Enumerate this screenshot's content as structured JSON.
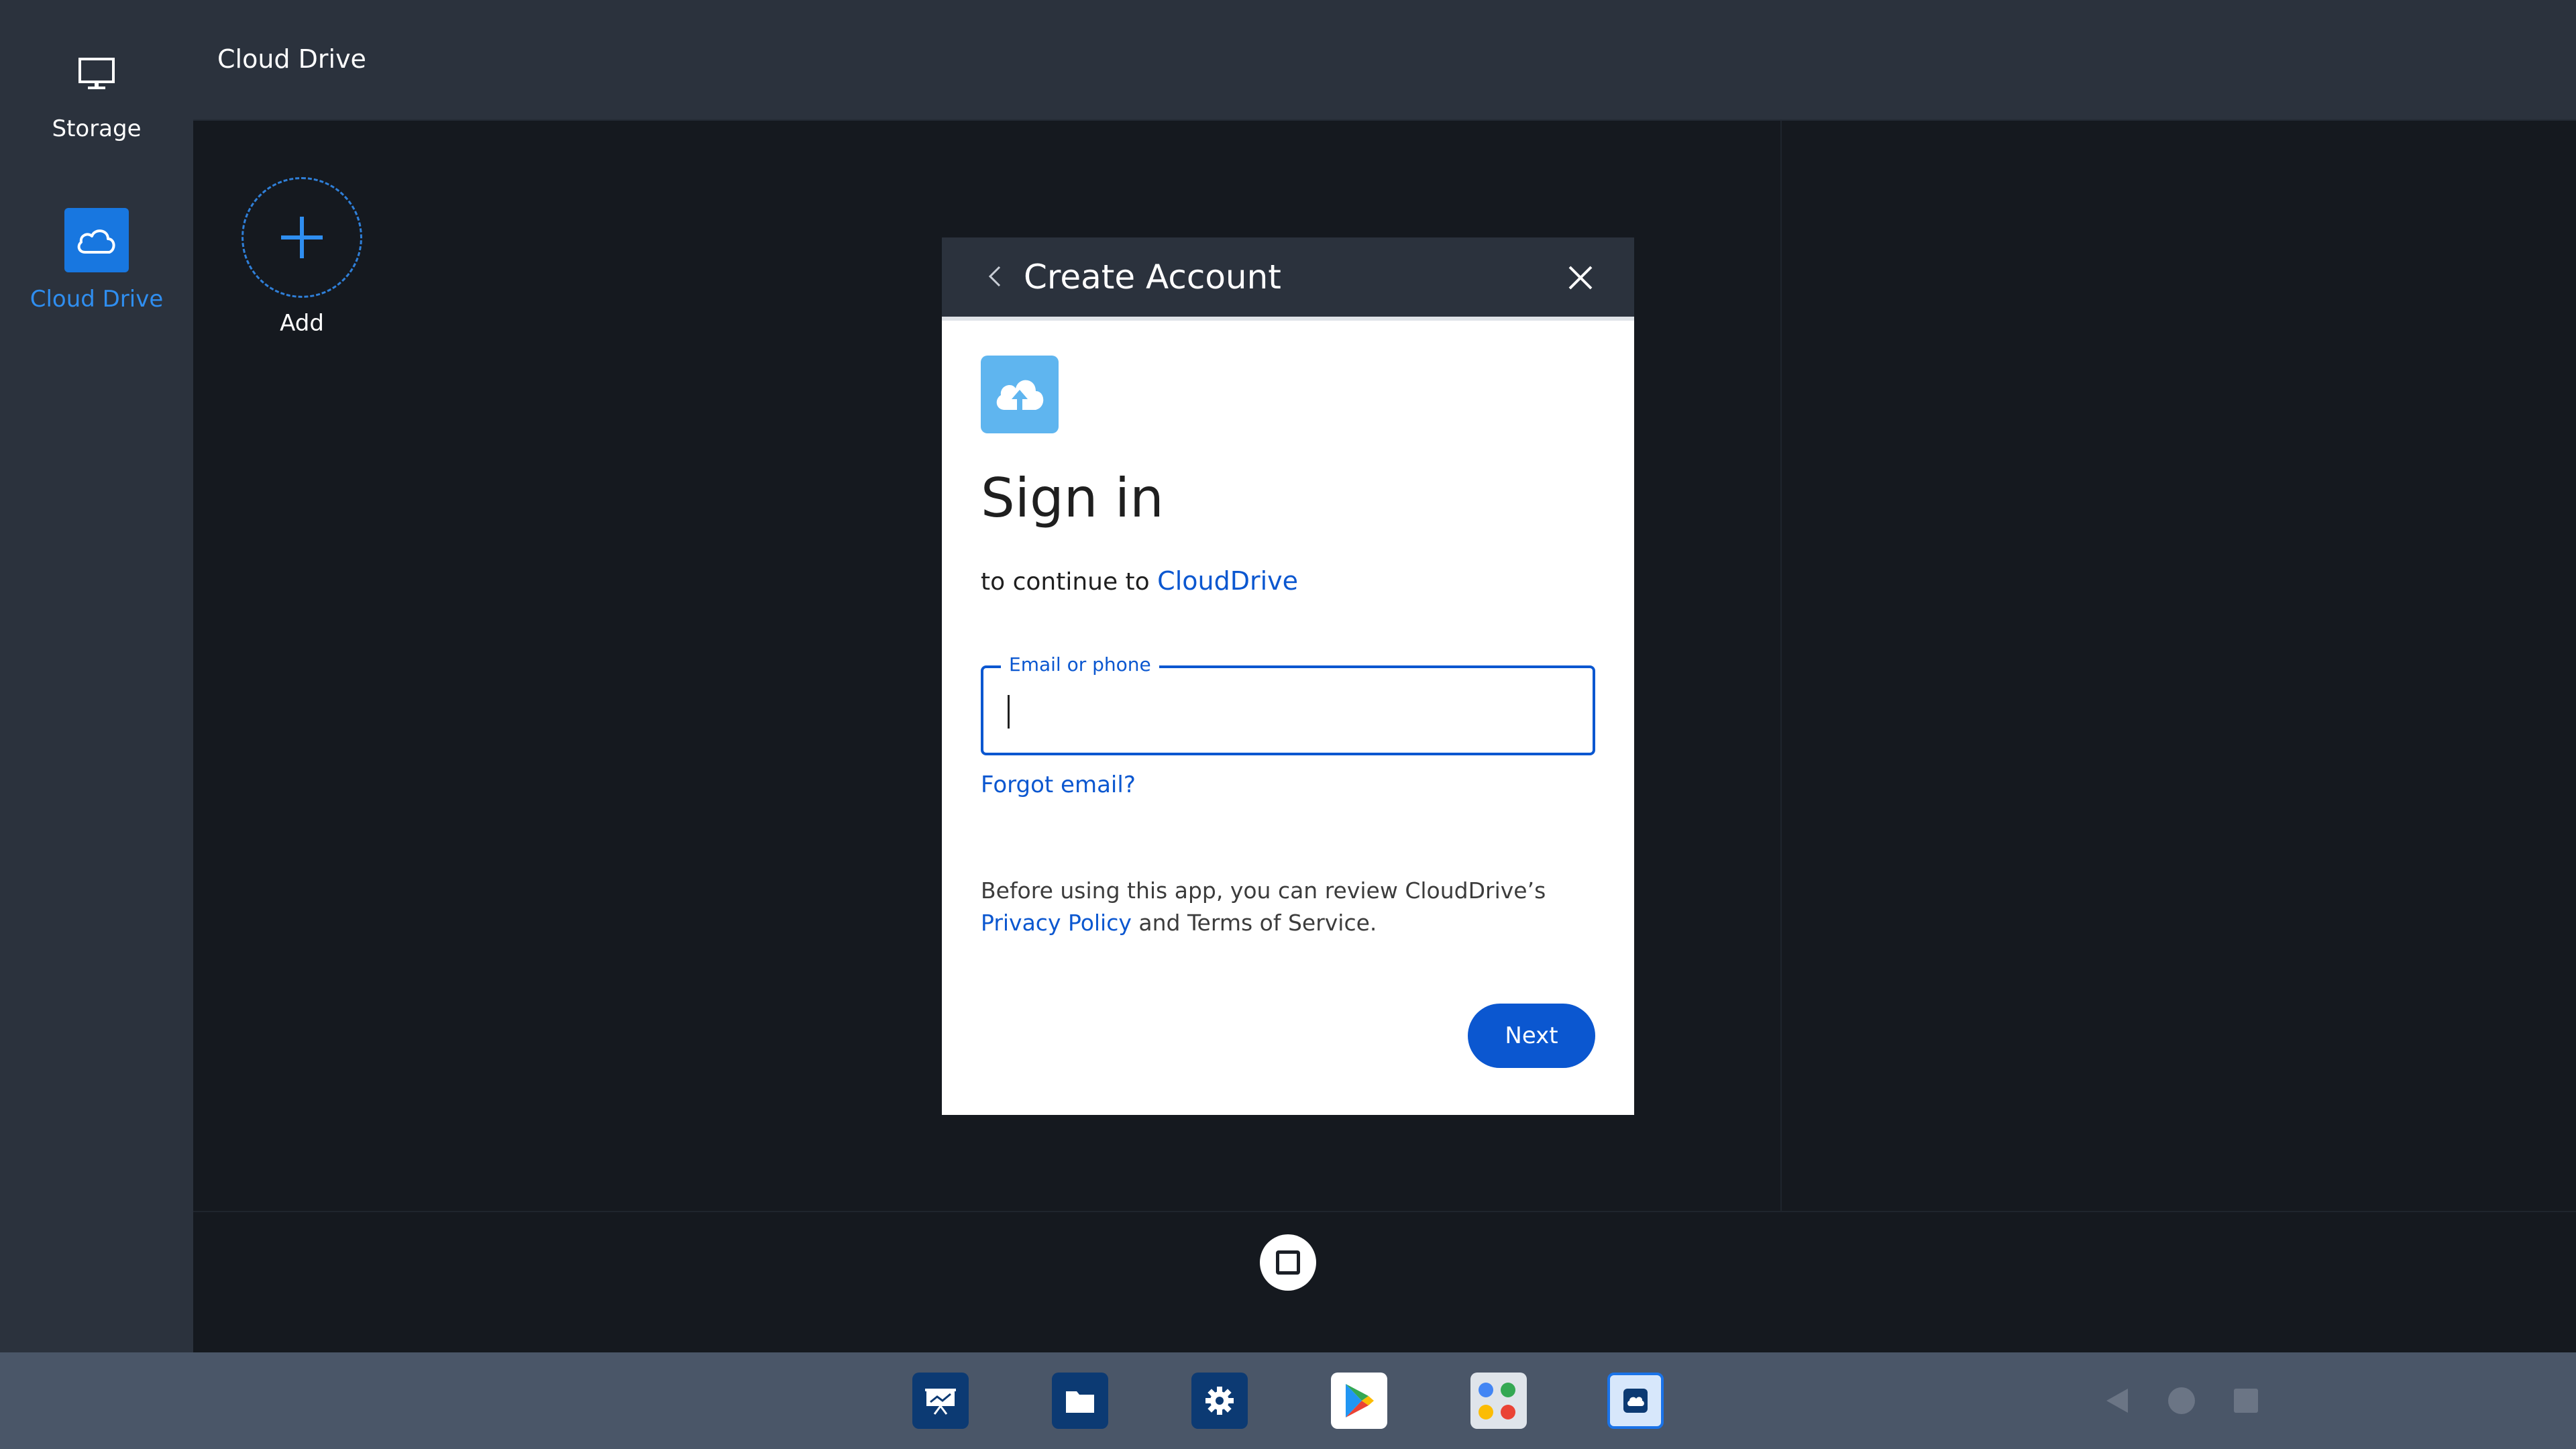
{
  "sidebar": {
    "items": [
      {
        "label": "Storage",
        "icon": "monitor-icon",
        "active": false
      },
      {
        "label": "Cloud Drive",
        "icon": "cloud-icon",
        "active": true
      }
    ]
  },
  "header": {
    "title": "Cloud Drive"
  },
  "main": {
    "add_label": "Add"
  },
  "dialog": {
    "title": "Create Account",
    "heading": "Sign in",
    "continue_prefix": "to continue to",
    "continue_brand": "CloudDrive",
    "email_label": "Email or phone",
    "email_value": "",
    "forgot_label": "Forgot email?",
    "privacy_prefix": "Before using this app, you can review CloudDrive’s",
    "privacy_link": "Privacy Policy",
    "privacy_suffix": "and Terms of Service.",
    "next_label": "Next"
  },
  "taskbar": {
    "apps": [
      "presentation-icon",
      "files-icon",
      "settings-icon",
      "play-store-icon",
      "google-apps-icon",
      "cloud-drive-app-icon"
    ],
    "nav": [
      "back-icon",
      "home-icon",
      "recents-icon"
    ]
  },
  "colors": {
    "accent": "#0b57d0",
    "sidebar_active": "#1877e0",
    "background": "#15191f",
    "panel": "#2b323d"
  }
}
